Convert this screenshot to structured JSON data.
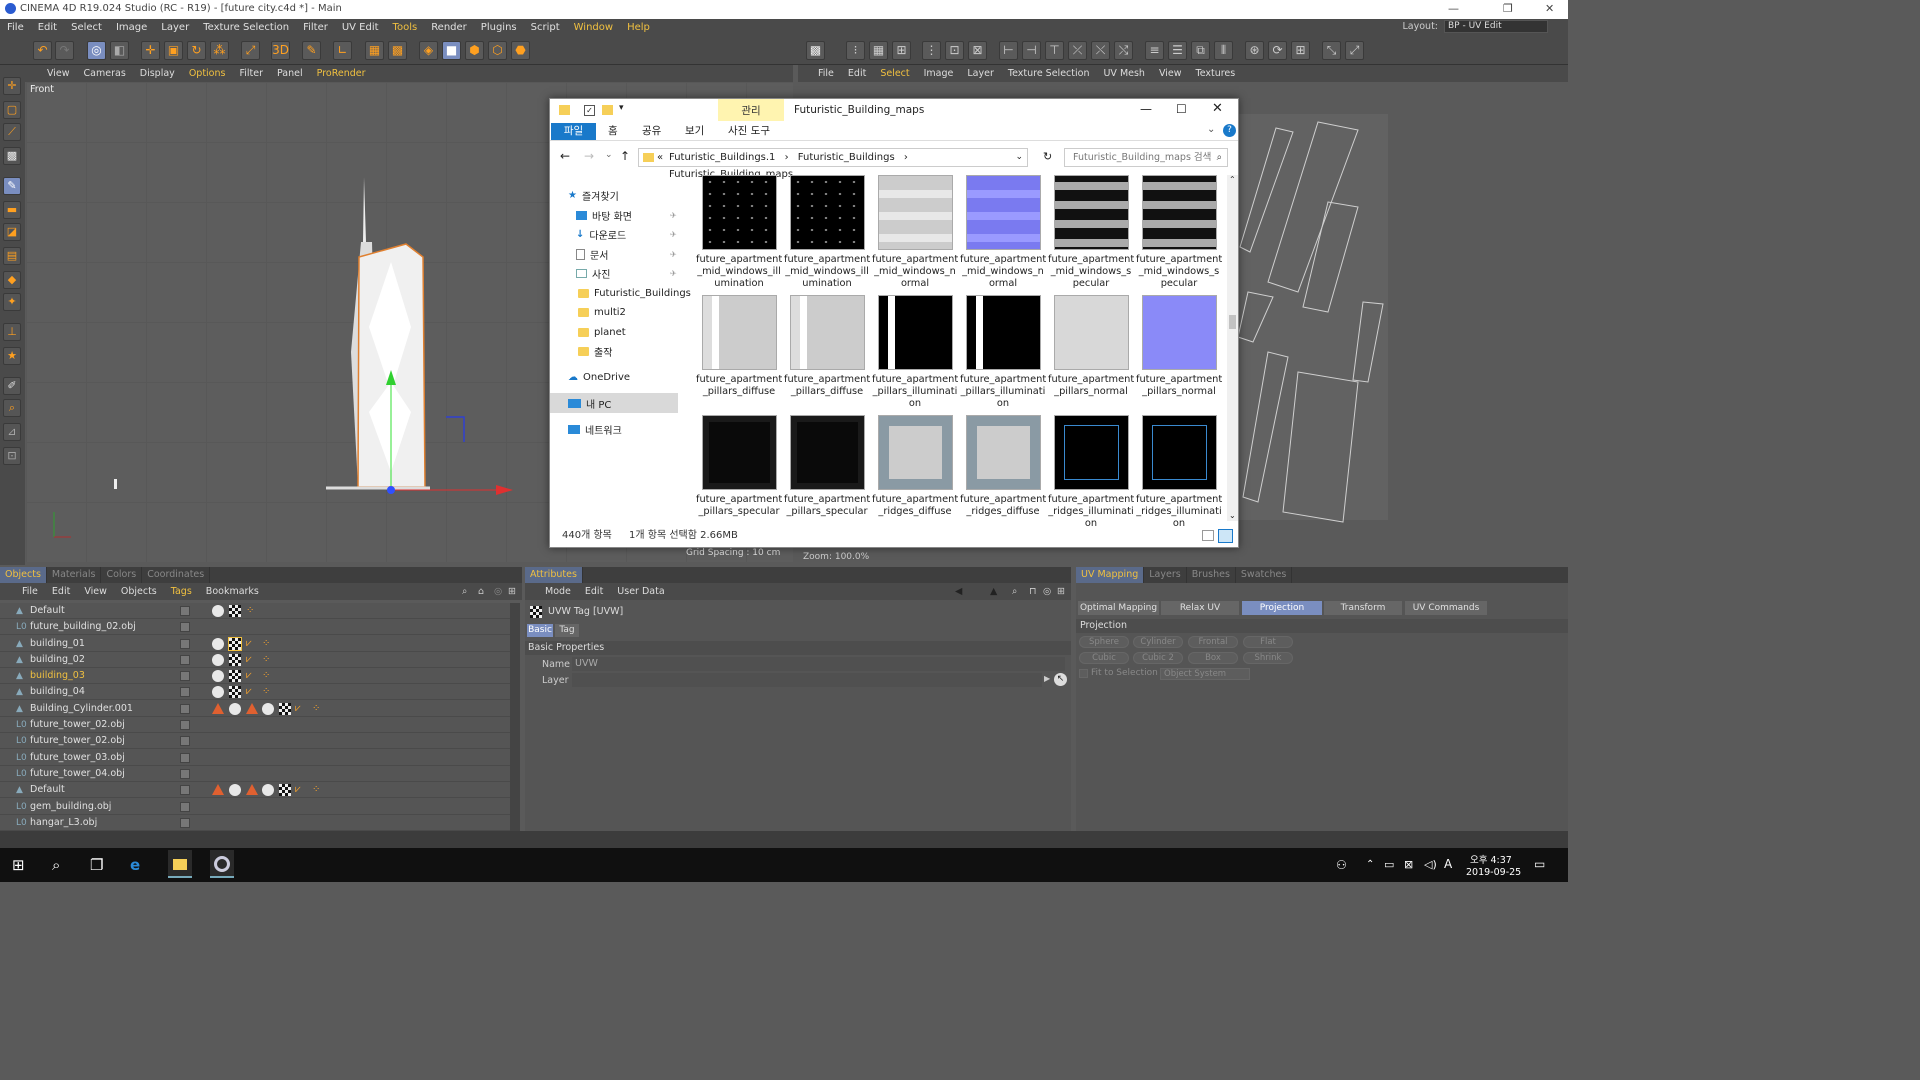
{
  "window": {
    "title": "CINEMA 4D R19.024 Studio (RC - R19) - [future city.c4d *] - Main"
  },
  "menubar": {
    "items": [
      "File",
      "Edit",
      "Select",
      "Image",
      "Layer",
      "Texture Selection",
      "Filter",
      "UV Edit",
      "Tools",
      "Render",
      "Plugins",
      "Script",
      "Window",
      "Help"
    ],
    "layout_label": "Layout:",
    "layout_value": "BP - UV Edit"
  },
  "viewport": {
    "menu": [
      "View",
      "Cameras",
      "Display",
      "Options",
      "Filter",
      "Panel",
      "ProRender"
    ],
    "label": "Front",
    "grid_spacing": "Grid Spacing : 10 cm"
  },
  "uv_view": {
    "menu": [
      "File",
      "Edit",
      "Select",
      "Image",
      "Layer",
      "Texture Selection",
      "UV Mesh",
      "View",
      "Textures"
    ],
    "zoom": "Zoom: 100.0%"
  },
  "explorer": {
    "manage_tab": "관리",
    "folder_title": "Futuristic_Building_maps",
    "ribbon": {
      "file": "파일",
      "home": "홈",
      "share": "공유",
      "view": "보기",
      "photo_tools": "사진 도구"
    },
    "path": [
      "«",
      "Futuristic_Buildings.1",
      "Futuristic_Buildings",
      "Futuristic_Building_maps"
    ],
    "search_placeholder": "Futuristic_Building_maps 검색",
    "nav": {
      "favorites": "즐겨찾기",
      "desktop": "바탕 화면",
      "downloads": "다운로드",
      "documents": "문서",
      "pictures": "사진",
      "folder1": "Futuristic_Buildings",
      "folder2": "multi2",
      "folder3": "planet",
      "folder4": "출작",
      "onedrive": "OneDrive",
      "mypc": "내 PC",
      "network": "네트워크"
    },
    "files": [
      {
        "l1": "future_apartment",
        "l2": "_mid_windows_ill",
        "l3": "umination"
      },
      {
        "l1": "future_apartment",
        "l2": "_mid_windows_ill",
        "l3": "umination"
      },
      {
        "l1": "future_apartment",
        "l2": "_mid_windows_n",
        "l3": "ormal"
      },
      {
        "l1": "future_apartment",
        "l2": "_mid_windows_n",
        "l3": "ormal"
      },
      {
        "l1": "future_apartment",
        "l2": "_mid_windows_s",
        "l3": "pecular"
      },
      {
        "l1": "future_apartment",
        "l2": "_mid_windows_s",
        "l3": "pecular"
      },
      {
        "l1": "future_apartment",
        "l2": "_pillars_diffuse",
        "l3": ""
      },
      {
        "l1": "future_apartment",
        "l2": "_pillars_diffuse",
        "l3": ""
      },
      {
        "l1": "future_apartment",
        "l2": "_pillars_illuminati",
        "l3": "on"
      },
      {
        "l1": "future_apartment",
        "l2": "_pillars_illuminati",
        "l3": "on"
      },
      {
        "l1": "future_apartment",
        "l2": "_pillars_normal",
        "l3": ""
      },
      {
        "l1": "future_apartment",
        "l2": "_pillars_normal",
        "l3": ""
      },
      {
        "l1": "future_apartment",
        "l2": "_pillars_specular",
        "l3": ""
      },
      {
        "l1": "future_apartment",
        "l2": "_pillars_specular",
        "l3": ""
      },
      {
        "l1": "future_apartment",
        "l2": "_ridges_diffuse",
        "l3": ""
      },
      {
        "l1": "future_apartment",
        "l2": "_ridges_diffuse",
        "l3": ""
      },
      {
        "l1": "future_apartment",
        "l2": "_ridges_illuminati",
        "l3": "on"
      },
      {
        "l1": "future_apartment",
        "l2": "_ridges_illuminati",
        "l3": "on"
      }
    ],
    "status_count": "440개 항목",
    "status_selected": "1개 항목 선택함 2.66MB"
  },
  "objects_panel": {
    "tabs": [
      "Objects",
      "Materials",
      "Colors",
      "Coordinates"
    ],
    "menu": [
      "File",
      "Edit",
      "View",
      "Objects",
      "Tags",
      "Bookmarks"
    ],
    "rows": [
      "Default",
      "future_building_02.obj",
      "building_01",
      "building_02",
      "building_03",
      "building_04",
      "Building_Cylinder.001",
      "future_tower_02.obj",
      "future_tower_02.obj",
      "future_tower_03.obj",
      "future_tower_04.obj",
      "Default",
      "gem_building.obj",
      "hangar_L3.obj"
    ]
  },
  "attributes_panel": {
    "tab": "Attributes",
    "menu": [
      "Mode",
      "Edit",
      "User Data"
    ],
    "tag_title": "UVW Tag [UVW]",
    "subtabs": [
      "Basic",
      "Tag"
    ],
    "section": "Basic Properties",
    "name_label": "Name",
    "name_value": "UVW",
    "layer_label": "Layer"
  },
  "uv_panel": {
    "tabs": [
      "UV Mapping",
      "Layers",
      "Brushes",
      "Swatches"
    ],
    "buttons": [
      "Optimal Mapping",
      "Relax UV",
      "Projection",
      "Transform",
      "UV Commands"
    ],
    "section": "Projection",
    "proj_row1": [
      "Sphere",
      "Cylinder",
      "Frontal",
      "Flat"
    ],
    "proj_row2": [
      "Cubic",
      "Cubic 2",
      "Box",
      "Shrink"
    ],
    "fit_label": "Fit to Selection",
    "fit_value": "Object System"
  },
  "taskbar": {
    "time": "오후 4:37",
    "date": "2019-09-25",
    "ime": "A"
  }
}
